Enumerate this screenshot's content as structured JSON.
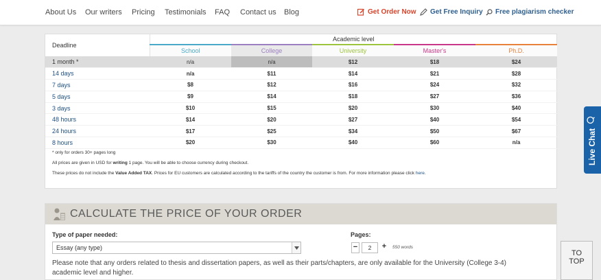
{
  "nav": {
    "links": [
      "About Us",
      "Our writers",
      "Pricing",
      "Testimonials",
      "FAQ",
      "Contact us",
      "Blog"
    ],
    "get_order": "Get Order Now",
    "get_inquiry": "Get Free Inquiry",
    "plagiarism": "Free plagiarism checker"
  },
  "prices": {
    "deadline_header": "Deadline",
    "academic_header": "Academic level",
    "levels": [
      {
        "label": "School",
        "color": "#4aa8c8"
      },
      {
        "label": "College",
        "color": "#9c7fc0"
      },
      {
        "label": "University",
        "color": "#9cc43c"
      },
      {
        "label": "Master's",
        "color": "#c8378a"
      },
      {
        "label": "Ph.D.",
        "color": "#e8813a"
      }
    ],
    "rows": [
      {
        "deadline": "1 month *",
        "values": [
          "n/a",
          "n/a",
          "$12",
          "$18",
          "$24"
        ]
      },
      {
        "deadline": "14 days",
        "values": [
          "n/a",
          "$11",
          "$14",
          "$21",
          "$28"
        ]
      },
      {
        "deadline": "7 days",
        "values": [
          "$8",
          "$12",
          "$16",
          "$24",
          "$32"
        ]
      },
      {
        "deadline": "5 days",
        "values": [
          "$9",
          "$14",
          "$18",
          "$27",
          "$36"
        ]
      },
      {
        "deadline": "3 days",
        "values": [
          "$10",
          "$15",
          "$20",
          "$30",
          "$40"
        ]
      },
      {
        "deadline": "48 hours",
        "values": [
          "$14",
          "$20",
          "$27",
          "$40",
          "$54"
        ]
      },
      {
        "deadline": "24 hours",
        "values": [
          "$17",
          "$25",
          "$34",
          "$50",
          "$67"
        ]
      },
      {
        "deadline": "8 hours",
        "values": [
          "$20",
          "$30",
          "$40",
          "$60",
          "n/a"
        ]
      }
    ],
    "note_orders": "* only for orders 30+ pages long",
    "note_usd_pre": "All prices are given in USD for ",
    "note_usd_bold": "writing",
    "note_usd_post": " 1 page. You will be able to choose currency during checkout.",
    "note_vat_pre": "These prices do not include the ",
    "note_vat_bold": "Value Added TAX",
    "note_vat_post": ". Prices for EU customers are calculated according to the tariffs of the country the customer is from. For more information please click ",
    "note_vat_link": "here",
    "note_vat_end": "."
  },
  "calc": {
    "title": "CALCULATE THE PRICE OF YOUR ORDER",
    "type_label": "Type of paper needed:",
    "type_value": "Essay (any type)",
    "pages_label": "Pages:",
    "pages_value": "2",
    "words": "550 words",
    "minus": "−",
    "plus": "+",
    "note": "Please note that any orders related to thesis and dissertation papers, as well as their parts/chapters, are only available for the University (College 3-4) academic level and higher."
  },
  "live_chat": "Live Chat",
  "to_top": {
    "line1": "TO",
    "line2": "TOP"
  }
}
